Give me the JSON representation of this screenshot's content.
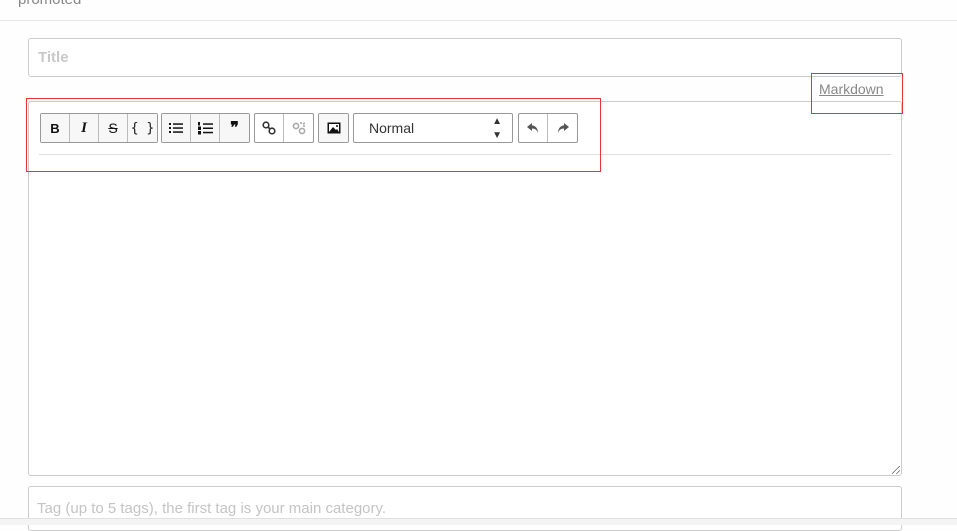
{
  "header": {
    "promoted_text": "promoted"
  },
  "title_input": {
    "placeholder": "Title",
    "value": ""
  },
  "editor_mode_link": "Markdown",
  "toolbar": {
    "bold": "B",
    "italic": "I",
    "strikethrough": "S",
    "code": "{ }",
    "quote": "❞",
    "format_select": {
      "selected": "Normal"
    }
  },
  "tag_input": {
    "placeholder": "Tag (up to 5 tags), the first tag is your main category.",
    "value": ""
  },
  "annotation_color": "#e8333a"
}
